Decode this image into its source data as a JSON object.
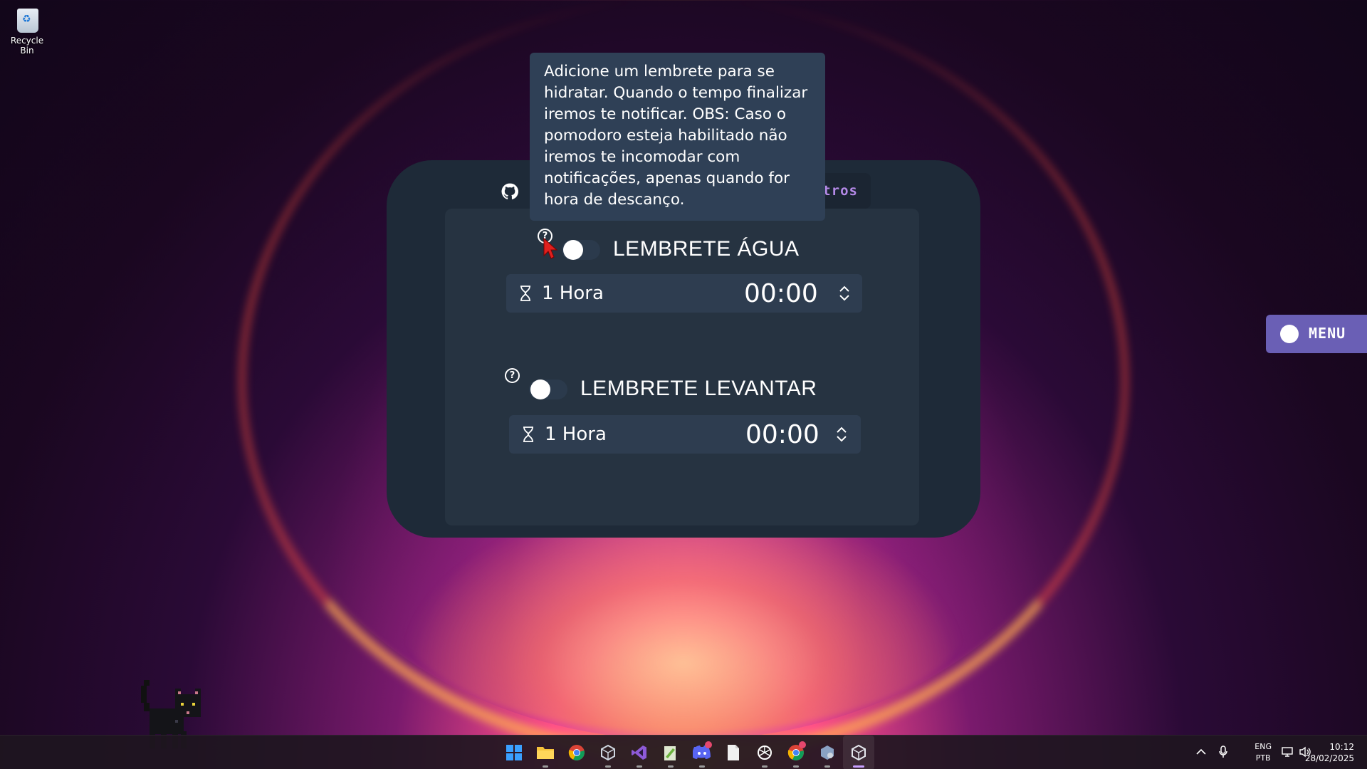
{
  "desktop": {
    "recycle_bin_label": "Recycle Bin"
  },
  "panel": {
    "tab_outros_label": "tros",
    "reminders": [
      {
        "title": "LEMBRETE ÁGUA",
        "duration": "1 Hora",
        "time": "00:00",
        "enabled": false
      },
      {
        "title": "LEMBRETE LEVANTAR",
        "duration": "1 Hora",
        "time": "00:00",
        "enabled": false
      }
    ]
  },
  "tooltip": {
    "text": "Adicione um lembrete para se hidratar. Quando o tempo finalizar iremos te notificar. OBS: Caso o pomodoro esteja habilitado não iremos te incomodar com notificações, apenas quando for hora de descanço."
  },
  "menu_button": {
    "label": "MENU"
  },
  "taskbar": {
    "apps": [
      "windows-start-icon",
      "file-explorer-icon",
      "chrome-icon",
      "app-cube-icon",
      "visual-studio-icon",
      "notepad-plus-icon",
      "discord-icon",
      "file-icon",
      "chatgpt-icon",
      "chrome-profile-icon",
      "settings-cube-icon",
      "active-app-icon"
    ],
    "lang_top": "ENG",
    "lang_bottom": "PTB",
    "time": "10:12",
    "date": "28/02/2025"
  },
  "colors": {
    "panel_bg": "#1e2a38",
    "inner_bg": "#263341",
    "tooltip_bg": "#2f4056",
    "menu_accent": "#6a5fb5",
    "tab_text": "#b58ae8"
  }
}
